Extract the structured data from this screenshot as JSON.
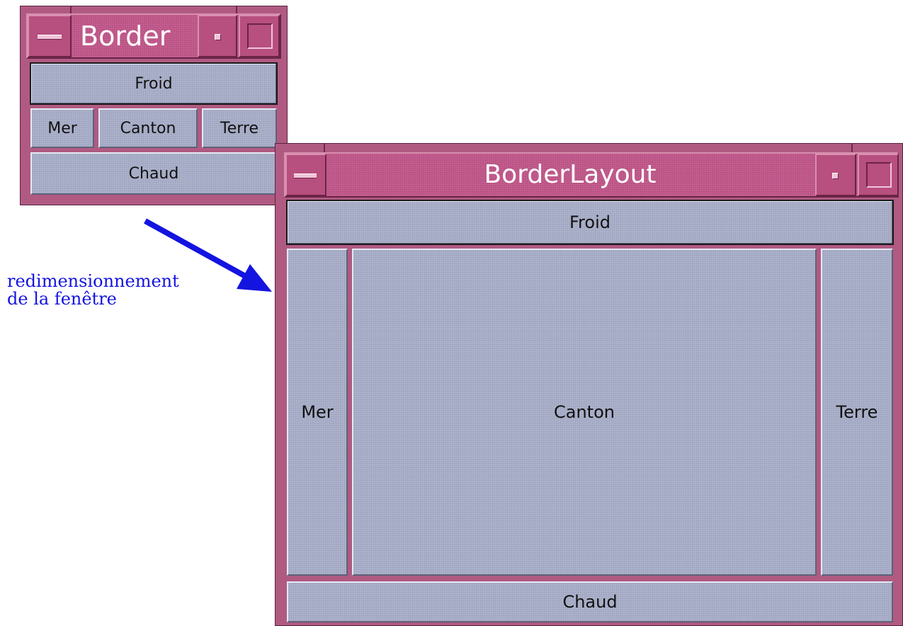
{
  "caption": {
    "line1": "redimensionnement",
    "line2": "de la fenêtre"
  },
  "small_window": {
    "title": "Border",
    "buttons": {
      "north": "Froid",
      "west": "Mer",
      "center": "Canton",
      "east": "Terre",
      "south": "Chaud"
    }
  },
  "large_window": {
    "title": "BorderLayout",
    "buttons": {
      "north": "Froid",
      "west": "Mer",
      "center": "Canton",
      "east": "Terre",
      "south": "Chaud"
    }
  },
  "colors": {
    "frame": "#b05a82",
    "button_face": "#aeb4cc",
    "arrow": "#1414e0",
    "caption": "#1414e0"
  },
  "icons": [
    "window-menu-icon",
    "minimize-icon",
    "maximize-icon",
    "resize-arrow-icon"
  ]
}
